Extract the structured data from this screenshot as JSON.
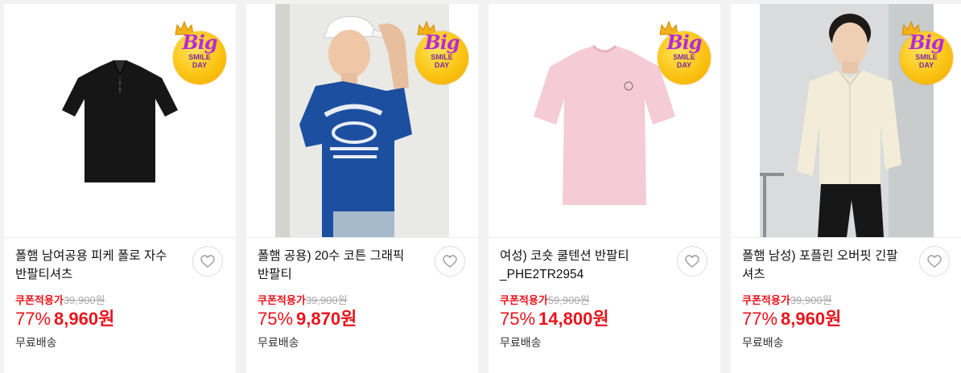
{
  "badge": {
    "big": "Big",
    "line1": "SMILE",
    "line2": "DAY"
  },
  "products": [
    {
      "title": "폴햄 남여공용 피케 폴로 자수 반팔티셔츠",
      "coupon_label": "쿠폰적용가",
      "original_price": "39,900원",
      "discount_rate": "77%",
      "sale_price": "8,960원",
      "shipping": "무료배송",
      "image": "black-polo-shirt"
    },
    {
      "title": "폴햄 공용) 20수 코튼 그래픽 반팔티",
      "coupon_label": "쿠폰적용가",
      "original_price": "39,900원",
      "discount_rate": "75%",
      "sale_price": "9,870원",
      "shipping": "무료배송",
      "image": "model-blue-university-tee"
    },
    {
      "title": "여성) 코숏 쿨텐션 반팔티 _PHE2TR2954",
      "coupon_label": "쿠폰적용가",
      "original_price": "59,900원",
      "discount_rate": "75%",
      "sale_price": "14,800원",
      "shipping": "무료배송",
      "image": "pink-tshirt"
    },
    {
      "title": "폴햄 남성) 포플린 오버핏 긴팔 셔츠",
      "coupon_label": "쿠폰적용가",
      "original_price": "39,900원",
      "discount_rate": "77%",
      "sale_price": "8,960원",
      "shipping": "무료배송",
      "image": "model-cream-poplin-shirt"
    }
  ]
}
